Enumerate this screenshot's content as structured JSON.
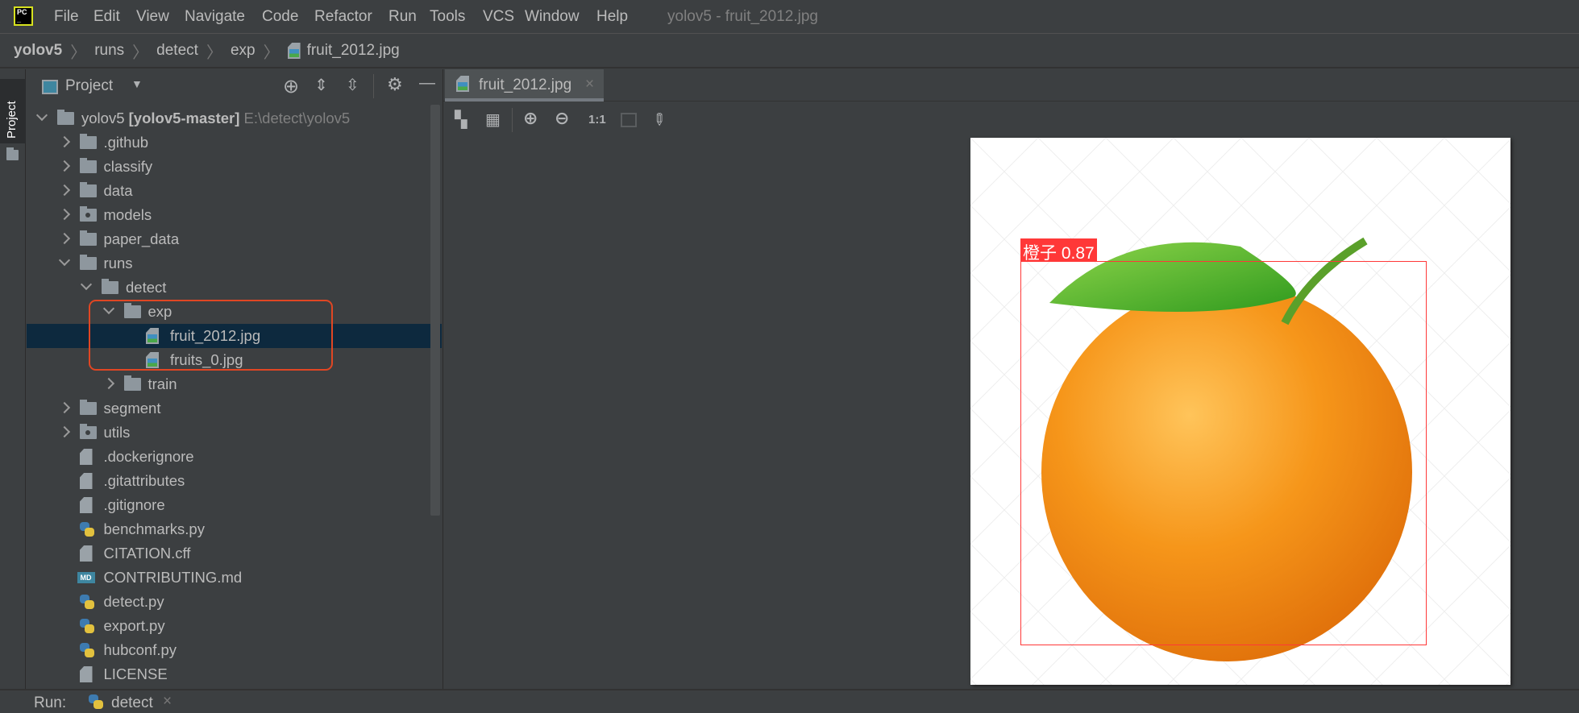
{
  "menu": {
    "items": [
      "File",
      "Edit",
      "View",
      "Navigate",
      "Code",
      "Refactor",
      "Run",
      "Tools",
      "VCS",
      "Window",
      "Help"
    ],
    "window_title": "yolov5 - fruit_2012.jpg"
  },
  "breadcrumb": [
    "yolov5",
    "runs",
    "detect",
    "exp",
    "fruit_2012.jpg"
  ],
  "stripe": {
    "project_label": "Project"
  },
  "panel": {
    "title": "Project"
  },
  "tree": [
    {
      "label": "yolov5",
      "bold": "[yolov5-master]",
      "path": "E:\\detect\\yolov5",
      "level": 0,
      "type": "folder",
      "arrow": "e"
    },
    {
      "label": ".github",
      "level": 1,
      "type": "folder",
      "arrow": "c"
    },
    {
      "label": "classify",
      "level": 1,
      "type": "folder",
      "arrow": "c"
    },
    {
      "label": "data",
      "level": 1,
      "type": "folder",
      "arrow": "c"
    },
    {
      "label": "models",
      "level": 1,
      "type": "pkg",
      "arrow": "c"
    },
    {
      "label": "paper_data",
      "level": 1,
      "type": "folder",
      "arrow": "c"
    },
    {
      "label": "runs",
      "level": 1,
      "type": "folder",
      "arrow": "e"
    },
    {
      "label": "detect",
      "level": 2,
      "type": "folder",
      "arrow": "e"
    },
    {
      "label": "exp",
      "level": 3,
      "type": "folder",
      "arrow": "e"
    },
    {
      "label": "fruit_2012.jpg",
      "level": 4,
      "type": "img",
      "selected": true
    },
    {
      "label": "fruits_0.jpg",
      "level": 4,
      "type": "img"
    },
    {
      "label": "train",
      "level": 3,
      "type": "folder",
      "arrow": "c"
    },
    {
      "label": "segment",
      "level": 1,
      "type": "folder",
      "arrow": "c"
    },
    {
      "label": "utils",
      "level": 1,
      "type": "pkg",
      "arrow": "c"
    },
    {
      "label": ".dockerignore",
      "level": 1,
      "type": "file"
    },
    {
      "label": ".gitattributes",
      "level": 1,
      "type": "file"
    },
    {
      "label": ".gitignore",
      "level": 1,
      "type": "file"
    },
    {
      "label": "benchmarks.py",
      "level": 1,
      "type": "py"
    },
    {
      "label": "CITATION.cff",
      "level": 1,
      "type": "file"
    },
    {
      "label": "CONTRIBUTING.md",
      "level": 1,
      "type": "md"
    },
    {
      "label": "detect.py",
      "level": 1,
      "type": "py"
    },
    {
      "label": "export.py",
      "level": 1,
      "type": "py"
    },
    {
      "label": "hubconf.py",
      "level": 1,
      "type": "py"
    },
    {
      "label": "LICENSE",
      "level": 1,
      "type": "file"
    }
  ],
  "editor": {
    "tab_label": "fruit_2012.jpg",
    "toolbar": {
      "actual_size": "1:1"
    }
  },
  "image": {
    "detection_label": "橙子 0.87",
    "md_badge": "MD"
  },
  "run": {
    "label": "Run:",
    "config": "detect"
  },
  "colors": {
    "selection": "#0d293e",
    "highlight_box": "#e04623",
    "bbox": "#ff3838"
  }
}
